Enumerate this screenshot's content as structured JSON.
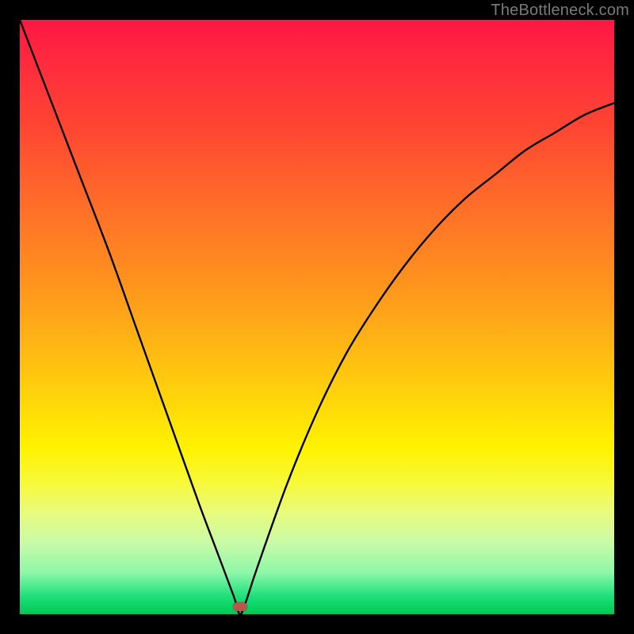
{
  "watermark": "TheBottleneck.com",
  "colors": {
    "background": "#000000",
    "gradient_top": "#ff1744",
    "gradient_mid": "#ffd60a",
    "gradient_bottom": "#00c853",
    "curve": "#000000",
    "marker": "#b55a4a"
  },
  "chart_data": {
    "type": "line",
    "title": "",
    "xlabel": "",
    "ylabel": "",
    "xlim": [
      0,
      100
    ],
    "ylim": [
      0,
      100
    ],
    "grid": false,
    "legend": false,
    "series": [
      {
        "name": "bottleneck-curve",
        "x": [
          0,
          5,
          10,
          15,
          20,
          25,
          30,
          33,
          36,
          37,
          38,
          40,
          45,
          50,
          55,
          60,
          65,
          70,
          75,
          80,
          85,
          90,
          95,
          100
        ],
        "y": [
          100,
          87,
          74,
          61,
          47,
          33,
          19,
          11,
          3,
          0,
          2,
          8,
          22,
          34,
          44,
          52,
          59,
          65,
          70,
          74,
          78,
          81,
          84,
          86
        ]
      }
    ],
    "markers": [
      {
        "name": "min-point",
        "x": 37,
        "y": 0
      }
    ],
    "notes": "Background is a vertical red→yellow→green gradient; y near 0 means green (good), y near 100 means red (bad). Curve minimum at x≈37."
  }
}
